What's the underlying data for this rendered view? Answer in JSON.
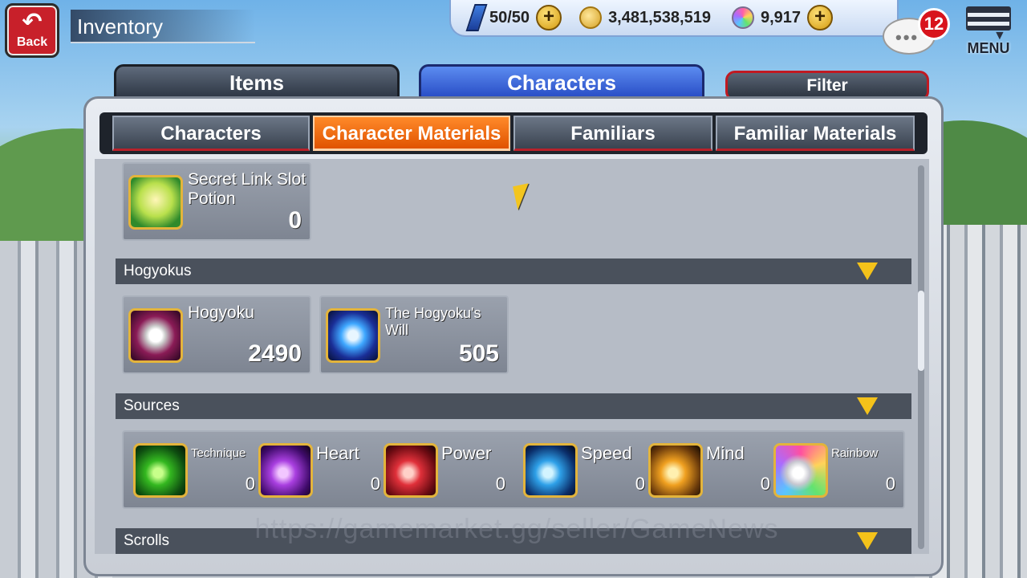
{
  "header": {
    "back_label": "Back",
    "title": "Inventory",
    "stamina": "50/50",
    "coins": "3,481,538,519",
    "gems": "9,917",
    "chat_badge": "12",
    "menu_label": "MENU"
  },
  "main_tabs": {
    "items_label": "Items",
    "characters_label": "Characters",
    "filter_label": "Filter"
  },
  "sub_tabs": [
    {
      "label": "Characters",
      "active": false
    },
    {
      "label": "Character Materials",
      "active": true
    },
    {
      "label": "Familiars",
      "active": false
    },
    {
      "label": "Familiar Materials",
      "active": false
    }
  ],
  "items": [
    {
      "name": "Secret Link Slot Potion",
      "qty": "0",
      "icon": "potion-icon"
    }
  ],
  "sections": {
    "hogyokus": {
      "title": "Hogyokus",
      "items": [
        {
          "name": "Hogyoku",
          "qty": "2490",
          "icon": "hogyoku-icon"
        },
        {
          "name": "The Hogyoku's Will",
          "qty": "505",
          "icon": "hogyoku-will-icon"
        }
      ]
    },
    "sources": {
      "title": "Sources",
      "items": [
        {
          "name": "Technique",
          "qty": "0",
          "color": "#34b820"
        },
        {
          "name": "Heart",
          "qty": "0",
          "color": "#a93fe0"
        },
        {
          "name": "Power",
          "qty": "0",
          "color": "#e0303a"
        },
        {
          "name": "Speed",
          "qty": "0",
          "color": "#2ea0e8"
        },
        {
          "name": "Mind",
          "qty": "0",
          "color": "#f0a020"
        },
        {
          "name": "Rainbow",
          "qty": "0",
          "color": "#c8c8d0"
        }
      ]
    },
    "scrolls": {
      "title": "Scrolls"
    }
  },
  "watermark": "https://gamemarket.gg/seller/GameNews"
}
